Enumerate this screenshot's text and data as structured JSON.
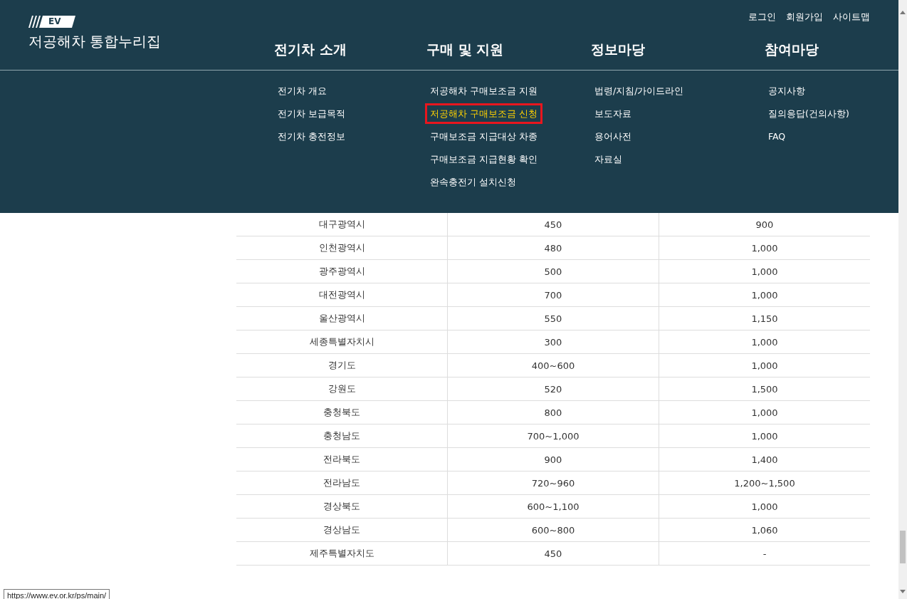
{
  "page": {
    "table": {
      "rows": [
        [
          "대구광역시",
          "450",
          "900"
        ],
        [
          "인천광역시",
          "480",
          "1,000"
        ],
        [
          "광주광역시",
          "500",
          "1,000"
        ],
        [
          "대전광역시",
          "700",
          "1,000"
        ],
        [
          "울산광역시",
          "550",
          "1,150"
        ],
        [
          "세종특별자치시",
          "300",
          "1,000"
        ],
        [
          "경기도",
          "400~600",
          "1,000"
        ],
        [
          "강원도",
          "520",
          "1,500"
        ],
        [
          "충청북도",
          "800",
          "1,000"
        ],
        [
          "충청남도",
          "700~1,000",
          "1,000"
        ],
        [
          "전라북도",
          "900",
          "1,400"
        ],
        [
          "전라남도",
          "720~960",
          "1,200~1,500"
        ],
        [
          "경상북도",
          "600~1,100",
          "1,000"
        ],
        [
          "경상남도",
          "600~800",
          "1,060"
        ],
        [
          "제주특별자치도",
          "450",
          "-"
        ]
      ]
    }
  },
  "header": {
    "logo_badge": "EV",
    "site_title": "저공해차 통합누리집",
    "util_links": [
      "로그인",
      "회원가입",
      "사이트맵"
    ],
    "menus": [
      {
        "title": "전기차 소개",
        "items": [
          {
            "label": "전기차 개요",
            "selected": false
          },
          {
            "label": "전기차 보급목적",
            "selected": false
          },
          {
            "label": "전기차 충전정보",
            "selected": false
          }
        ]
      },
      {
        "title": "구매 및 지원",
        "items": [
          {
            "label": "저공해차 구매보조금 지원",
            "selected": false
          },
          {
            "label": "저공해차 구매보조금 신청",
            "selected": true
          },
          {
            "label": "구매보조금 지급대상 차종",
            "selected": false
          },
          {
            "label": "구매보조금 지급현황 확인",
            "selected": false
          },
          {
            "label": "완속충전기 설치신청",
            "selected": false
          }
        ]
      },
      {
        "title": "정보마당",
        "items": [
          {
            "label": "법령/지침/가이드라인",
            "selected": false
          },
          {
            "label": "보도자료",
            "selected": false
          },
          {
            "label": "용어사전",
            "selected": false
          },
          {
            "label": "자료실",
            "selected": false
          }
        ]
      },
      {
        "title": "참여마당",
        "items": [
          {
            "label": "공지사항",
            "selected": false
          },
          {
            "label": "질의응답(건의사항)",
            "selected": false
          },
          {
            "label": "FAQ",
            "selected": false
          }
        ]
      }
    ]
  },
  "status_url": "https://www.ev.or.kr/ps/main/"
}
